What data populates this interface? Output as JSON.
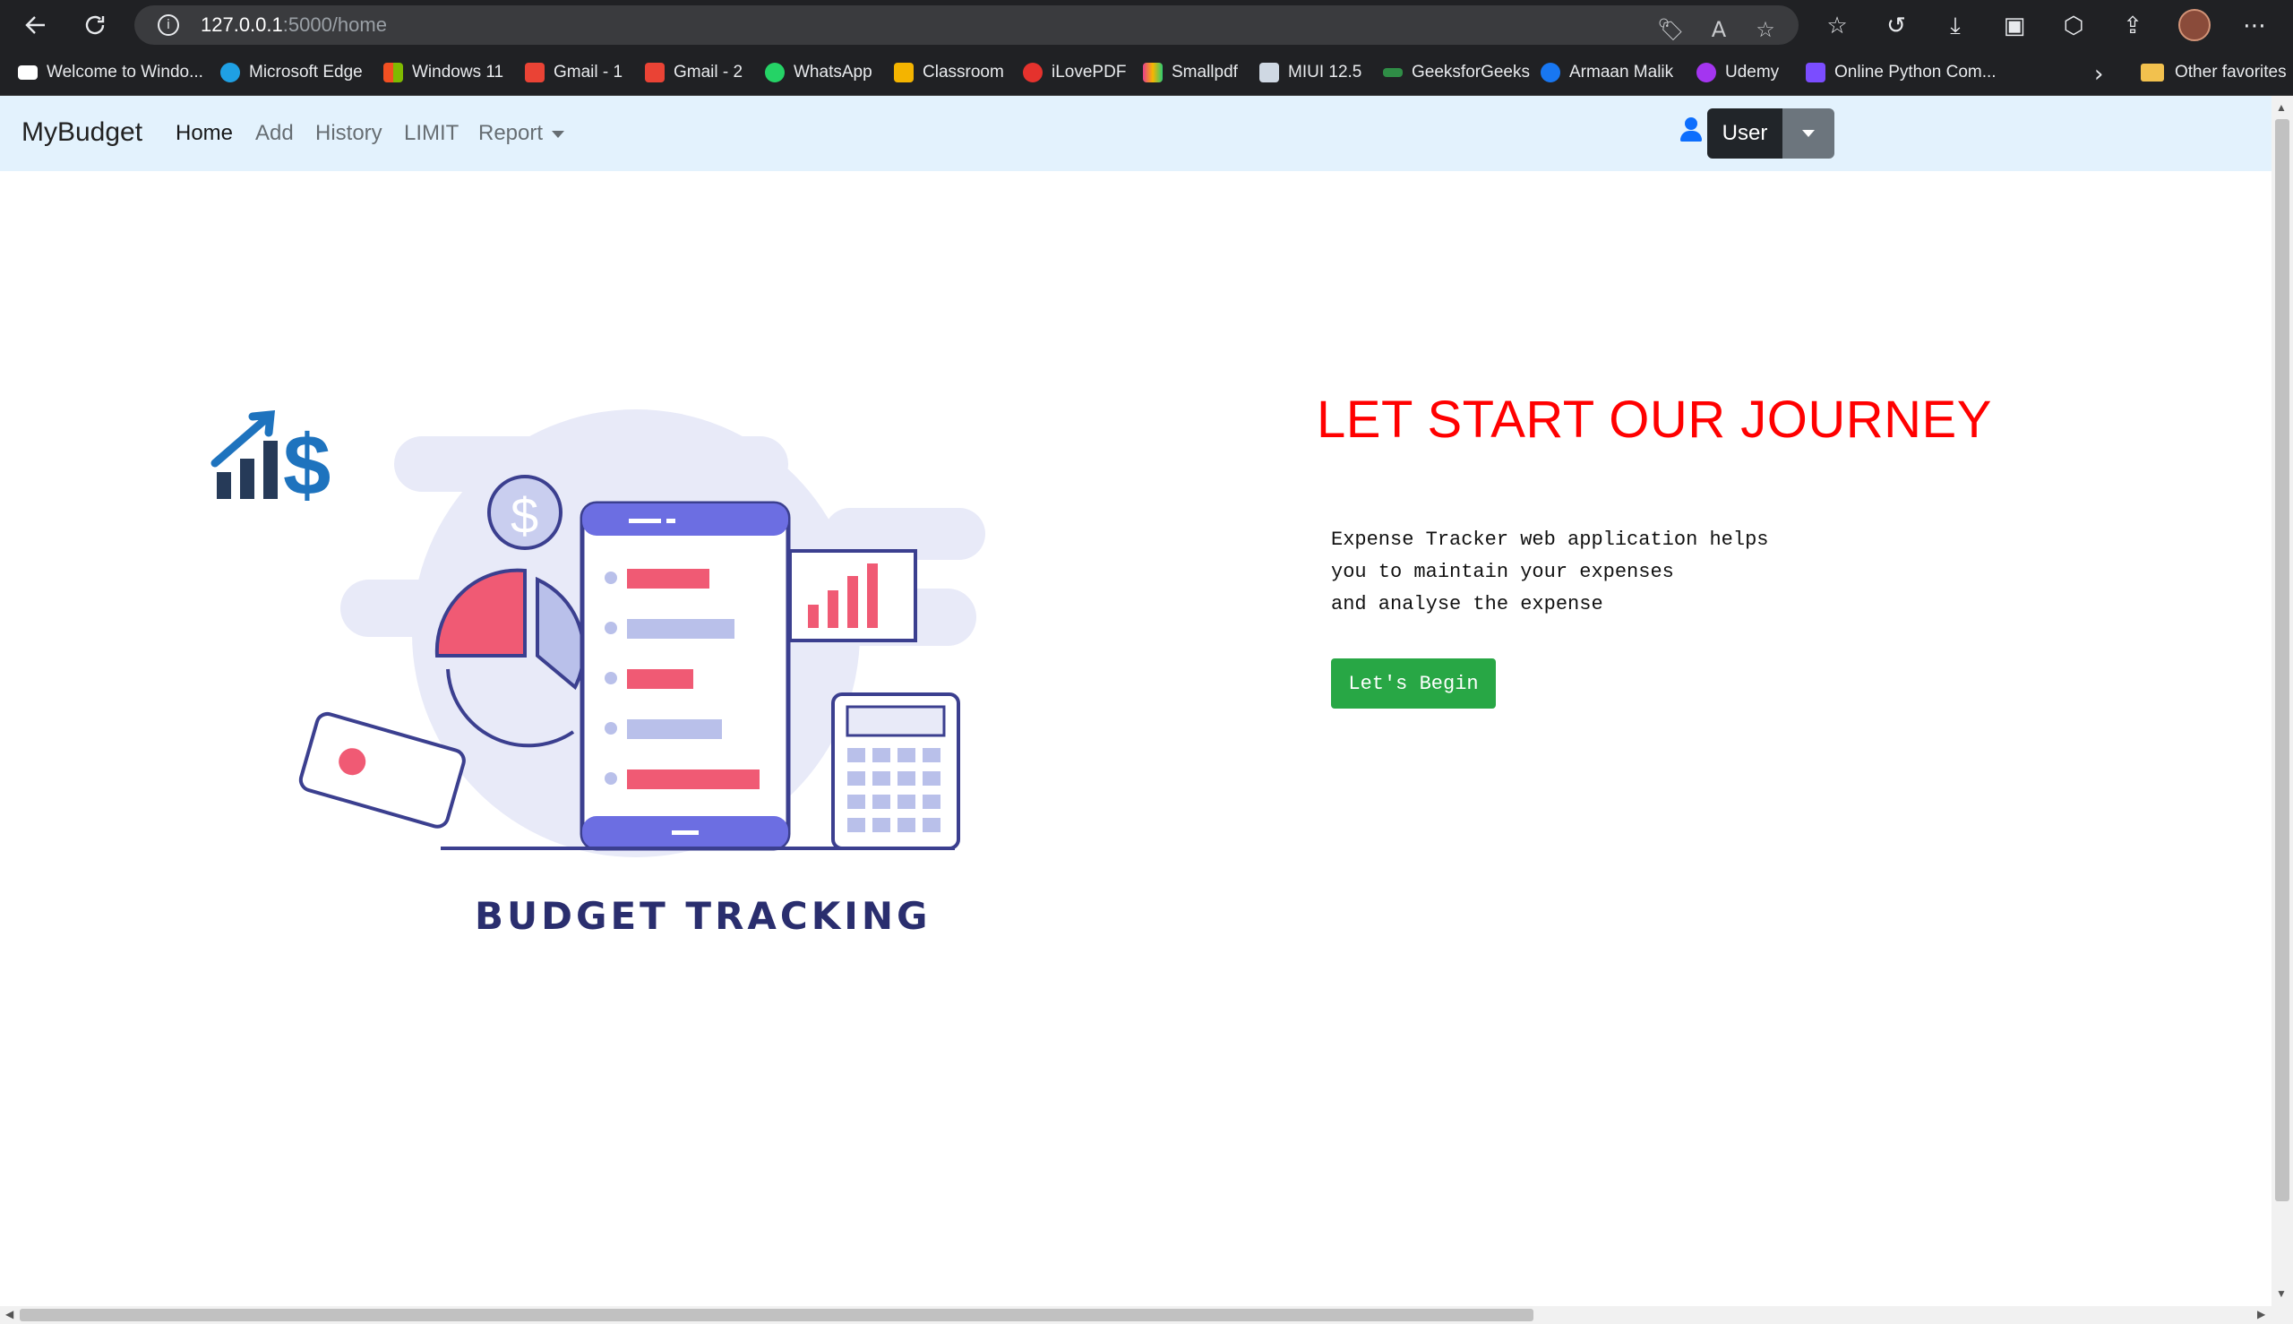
{
  "browser": {
    "url_host": "127.0.0.1",
    "url_path": ":5000/home",
    "bookmarks": [
      {
        "label": "Welcome to Windo...",
        "color": "#ffffff"
      },
      {
        "label": "Microsoft Edge",
        "color": "#1fa0e4"
      },
      {
        "label": "Windows 11",
        "color": "#f25022"
      },
      {
        "label": "Gmail - 1",
        "color": "#ea4335"
      },
      {
        "label": "Gmail - 2",
        "color": "#ea4335"
      },
      {
        "label": "WhatsApp",
        "color": "#25d366"
      },
      {
        "label": "Classroom",
        "color": "#f4b400"
      },
      {
        "label": "iLovePDF",
        "color": "#e5322d"
      },
      {
        "label": "Smallpdf",
        "color": "#f7b500"
      },
      {
        "label": "MIUI 12.5",
        "color": "#cfd8e3"
      },
      {
        "label": "GeeksforGeeks",
        "color": "#2f8d46"
      },
      {
        "label": "Armaan Malik",
        "color": "#1877f2"
      },
      {
        "label": "Udemy",
        "color": "#a435f0"
      },
      {
        "label": "Online Python Com...",
        "color": "#7b4dff"
      }
    ],
    "other_favorites": "Other favorites"
  },
  "navbar": {
    "brand": "MyBudget",
    "links": [
      "Home",
      "Add",
      "History",
      "LIMIT",
      "Report"
    ],
    "user_button": "User"
  },
  "hero": {
    "illustration_caption": "BUDGET TRACKING",
    "title": "LET START OUR JOURNEY",
    "description_lines": [
      "Expense Tracker web application helps",
      "you to maintain your expenses",
      "and analyse the expense"
    ],
    "cta": "Let's Begin"
  },
  "colors": {
    "navbar_bg": "#e3f2fd",
    "title_red": "#ff0000",
    "cta_green": "#28a745",
    "user_btn_dark": "#212529",
    "user_toggle_grey": "#6c757d"
  }
}
